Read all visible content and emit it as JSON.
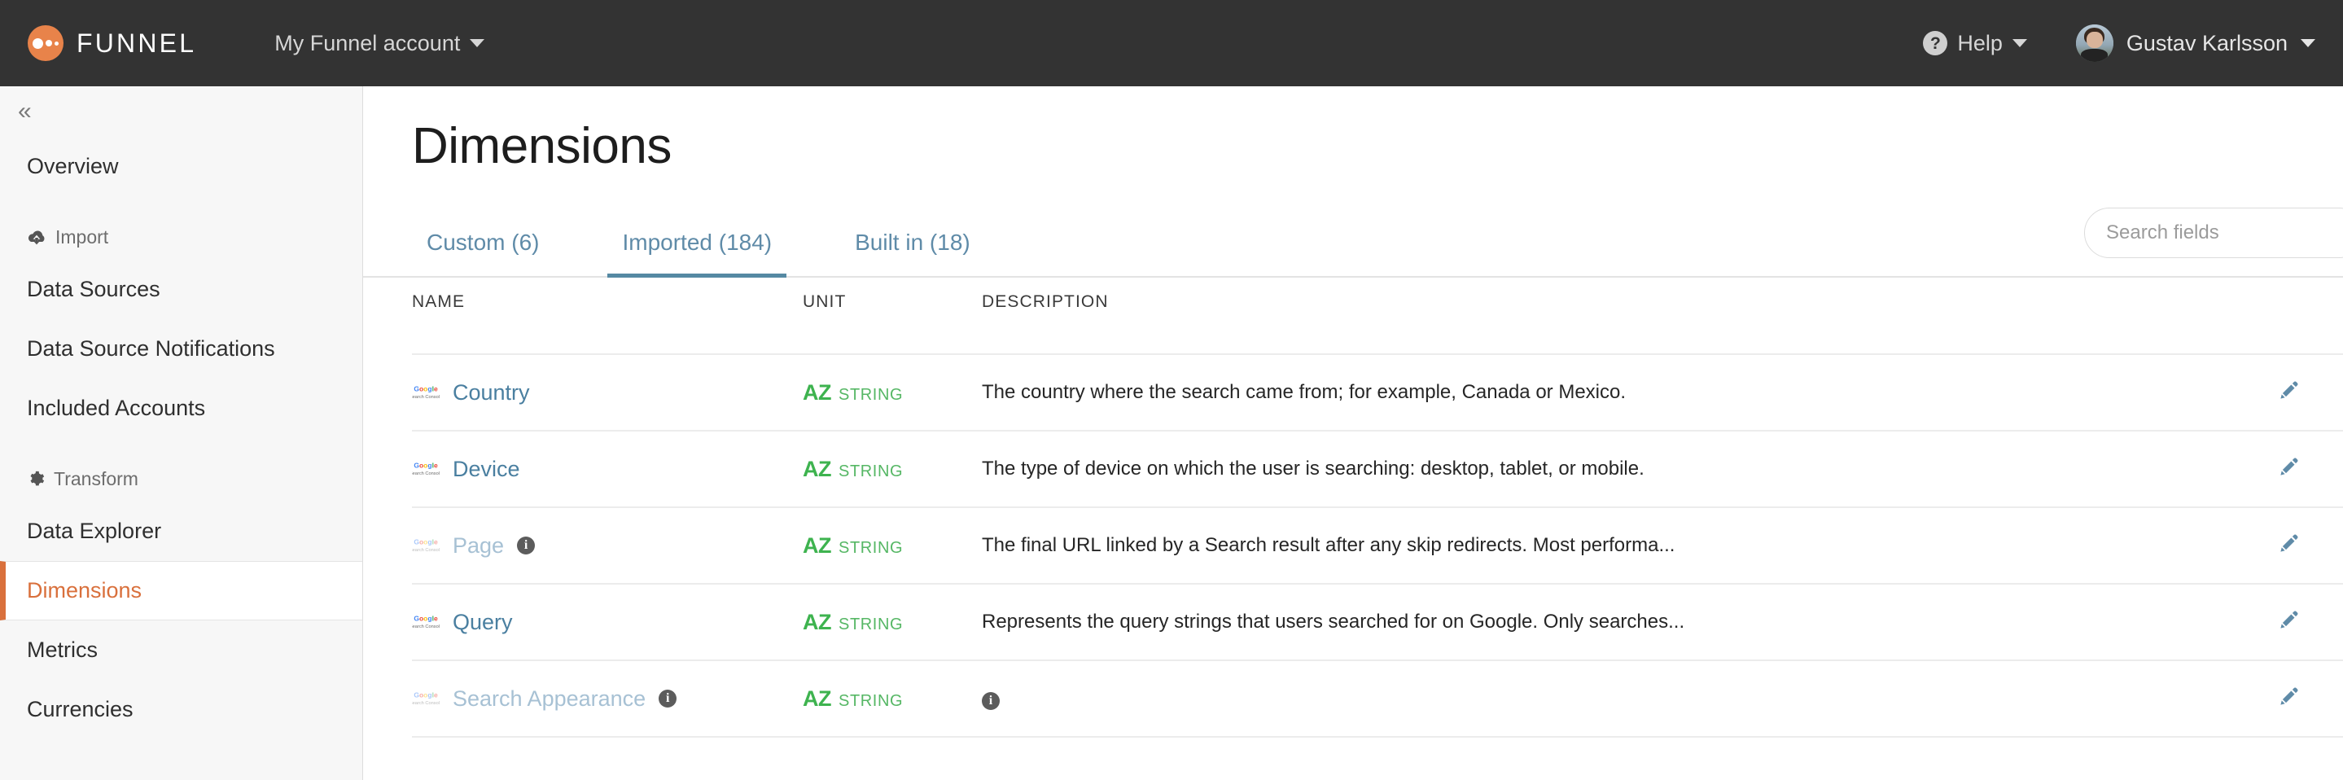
{
  "topbar": {
    "brand": "FUNNEL",
    "brand_color": "#e8834a",
    "account_label": "My Funnel account",
    "help_label": "Help",
    "help_icon": "question-circle-icon",
    "user_name": "Gustav Karlsson"
  },
  "sidebar": {
    "collapse_icon": "«",
    "items": [
      {
        "label": "Overview",
        "type": "link",
        "active": false
      },
      {
        "label": "Import",
        "type": "group",
        "icon": "cloud-download-icon"
      },
      {
        "label": "Data Sources",
        "type": "link",
        "active": false
      },
      {
        "label": "Data Source Notifications",
        "type": "link",
        "active": false
      },
      {
        "label": "Included Accounts",
        "type": "link",
        "active": false
      },
      {
        "label": "Transform",
        "type": "group",
        "icon": "gear-icon"
      },
      {
        "label": "Data Explorer",
        "type": "link",
        "active": false
      },
      {
        "label": "Dimensions",
        "type": "link",
        "active": true
      },
      {
        "label": "Metrics",
        "type": "link",
        "active": false
      },
      {
        "label": "Currencies",
        "type": "link",
        "active": false
      }
    ],
    "active_color": "#d9703c"
  },
  "main": {
    "title": "Dimensions",
    "tabs": [
      {
        "label": "Custom (6)",
        "active": false
      },
      {
        "label": "Imported (184)",
        "active": true
      },
      {
        "label": "Built in (18)",
        "active": false
      }
    ],
    "tab_accent": "#5589a3",
    "search": {
      "placeholder": "Search fields",
      "value": "",
      "icon": "search-icon"
    },
    "table": {
      "columns": [
        "NAME",
        "UNIT",
        "DESCRIPTION",
        ""
      ],
      "clipped_row": {
        "name": "",
        "unit_code": "",
        "unit_type": "",
        "action": "-"
      },
      "rows": [
        {
          "source_icon": "google-search-console-icon",
          "name": "Country",
          "faded": false,
          "has_info": false,
          "unit_code": "AZ",
          "unit_type": "STRING",
          "description": "The country where the search came from; for example, Canada or Mexico.",
          "desc_info_icon": false,
          "action_icon": "pencil-icon"
        },
        {
          "source_icon": "google-search-console-icon",
          "name": "Device",
          "faded": false,
          "has_info": false,
          "unit_code": "AZ",
          "unit_type": "STRING",
          "description": "The type of device on which the user is searching: desktop, tablet, or mobile.",
          "desc_info_icon": false,
          "action_icon": "pencil-icon"
        },
        {
          "source_icon": "google-search-console-icon",
          "name": "Page",
          "faded": true,
          "has_info": true,
          "unit_code": "AZ",
          "unit_type": "STRING",
          "description": "The final URL linked by a Search result after any skip redirects. Most performa...",
          "desc_info_icon": false,
          "action_icon": "pencil-icon"
        },
        {
          "source_icon": "google-search-console-icon",
          "name": "Query",
          "faded": false,
          "has_info": false,
          "unit_code": "AZ",
          "unit_type": "STRING",
          "description": "Represents the query strings that users searched for on Google. Only searches...",
          "desc_info_icon": false,
          "action_icon": "pencil-icon"
        },
        {
          "source_icon": "google-search-console-icon",
          "name": "Search Appearance",
          "faded": true,
          "has_info": true,
          "unit_code": "AZ",
          "unit_type": "STRING",
          "description": "",
          "desc_info_icon": true,
          "action_icon": "pencil-icon"
        }
      ]
    }
  }
}
